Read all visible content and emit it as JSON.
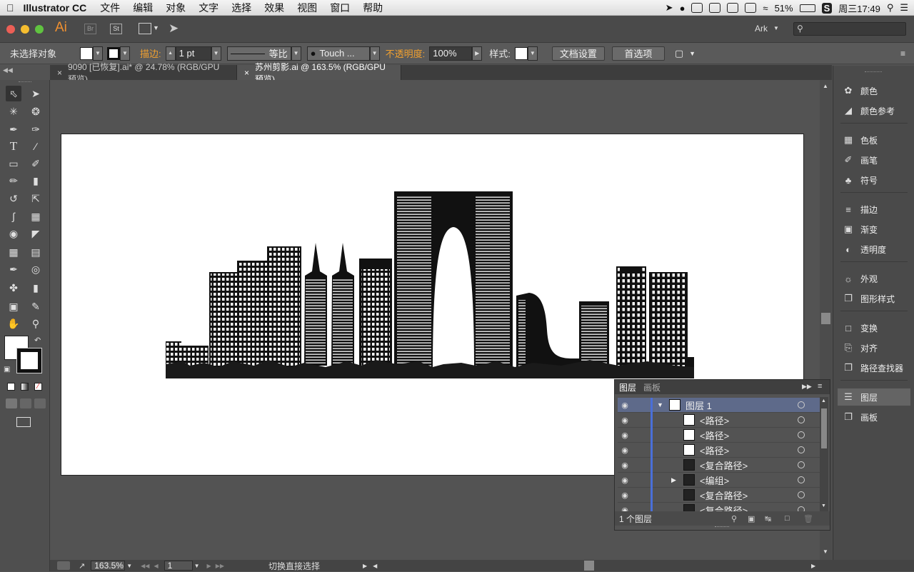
{
  "menubar": {
    "app": "Illustrator CC",
    "items": [
      "文件",
      "编辑",
      "对象",
      "文字",
      "选择",
      "效果",
      "视图",
      "窗口",
      "帮助"
    ],
    "battery": "51%",
    "clock": "周三17:49"
  },
  "appbar": {
    "logo": "Ai",
    "br": "Br",
    "st": "St",
    "workspace": "Ark",
    "search_placeholder": ""
  },
  "control": {
    "selection": "未选择对象",
    "stroke_label": "描边:",
    "stroke_value": "1 pt",
    "profile": "等比",
    "brush": "Touch ...",
    "opacity_label": "不透明度:",
    "opacity_value": "100%",
    "style_label": "样式:",
    "doc_settings": "文档设置",
    "preferences": "首选项"
  },
  "tabs": [
    {
      "label": "9090 [已恢复].ai* @ 24.78% (RGB/GPU 预览)",
      "close": "×"
    },
    {
      "label": "苏州剪影.ai @ 163.5% (RGB/GPU 预览)",
      "close": "×"
    }
  ],
  "dock": {
    "items": [
      "颜色",
      "颜色参考",
      "色板",
      "画笔",
      "符号",
      "描边",
      "渐变",
      "透明度",
      "外观",
      "图形样式",
      "变换",
      "对齐",
      "路径查找器",
      "图层",
      "画板"
    ],
    "active": "图层"
  },
  "layers_panel": {
    "tabs": [
      "图层",
      "画板"
    ],
    "rows": [
      {
        "name": "图层 1"
      },
      {
        "name": "<路径>"
      },
      {
        "name": "<路径>"
      },
      {
        "name": "<路径>"
      },
      {
        "name": "<复合路径>"
      },
      {
        "name": "<编组>"
      },
      {
        "name": "<复合路径>"
      },
      {
        "name": "<复合路径>"
      }
    ],
    "footer": "1 个图层"
  },
  "status": {
    "zoom": "163.5%",
    "page": "1",
    "tool_hint": "切换直接选择"
  },
  "colors": {
    "accent": "#f0a030",
    "layer_bar": "#4a6fd8",
    "canvas": "#535353"
  }
}
